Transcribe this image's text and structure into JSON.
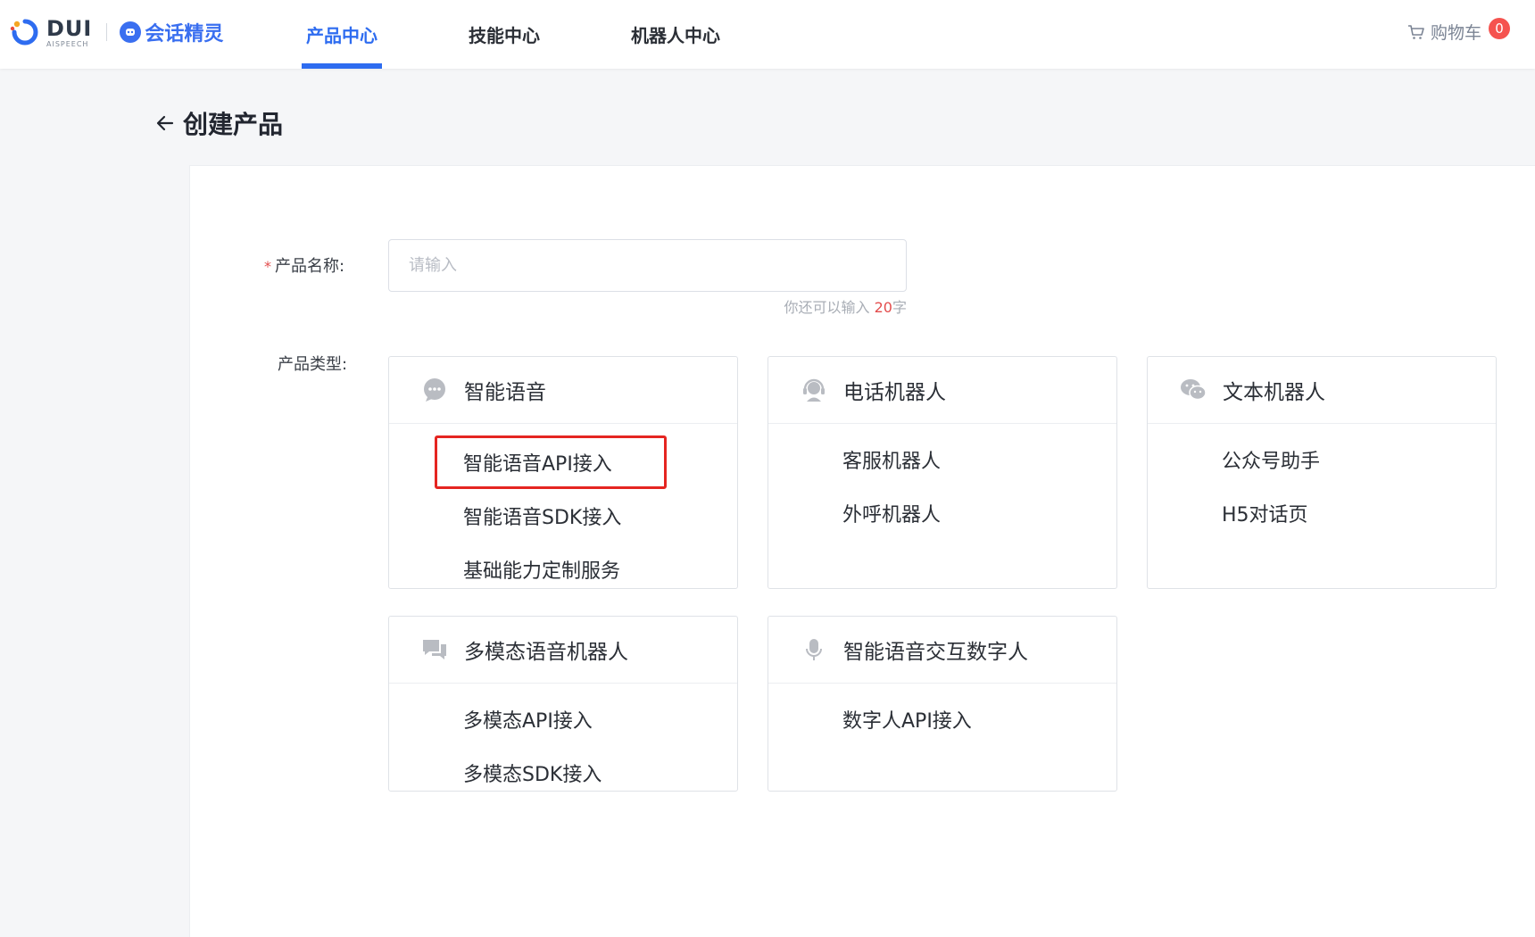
{
  "header": {
    "logo_text": "DUI",
    "logo_sub": "AISPEECH",
    "brand2": "会话精灵",
    "nav": [
      {
        "label": "产品中心",
        "active": true
      },
      {
        "label": "技能中心",
        "active": false
      },
      {
        "label": "机器人中心",
        "active": false
      }
    ],
    "cart_label": "购物车",
    "cart_count": "0"
  },
  "page": {
    "title": "创建产品"
  },
  "form": {
    "name_label": "产品名称:",
    "name_required_mark": "*",
    "name_placeholder": "请输入",
    "name_value": "",
    "counter_prefix": "你还可以输入 ",
    "counter_num": "20",
    "counter_suffix": "字",
    "type_label": "产品类型:"
  },
  "cards": [
    {
      "title": "智能语音",
      "icon": "chat-bubble-icon",
      "options": [
        "智能语音API接入",
        "智能语音SDK接入",
        "基础能力定制服务"
      ],
      "selected_index": 0
    },
    {
      "title": "电话机器人",
      "icon": "headset-icon",
      "options": [
        "客服机器人",
        "外呼机器人"
      ]
    },
    {
      "title": "文本机器人",
      "icon": "wechat-icon",
      "options": [
        "公众号助手",
        "H5对话页"
      ]
    },
    {
      "title": "多模态语音机器人",
      "icon": "chat-multi-icon",
      "options": [
        "多模态API接入",
        "多模态SDK接入"
      ]
    },
    {
      "title": "智能语音交互数字人",
      "icon": "microphone-icon",
      "options": [
        "数字人API接入"
      ]
    }
  ],
  "colors": {
    "accent": "#2e6cf0",
    "selected_border": "#e52521",
    "badge": "#f5534f"
  }
}
